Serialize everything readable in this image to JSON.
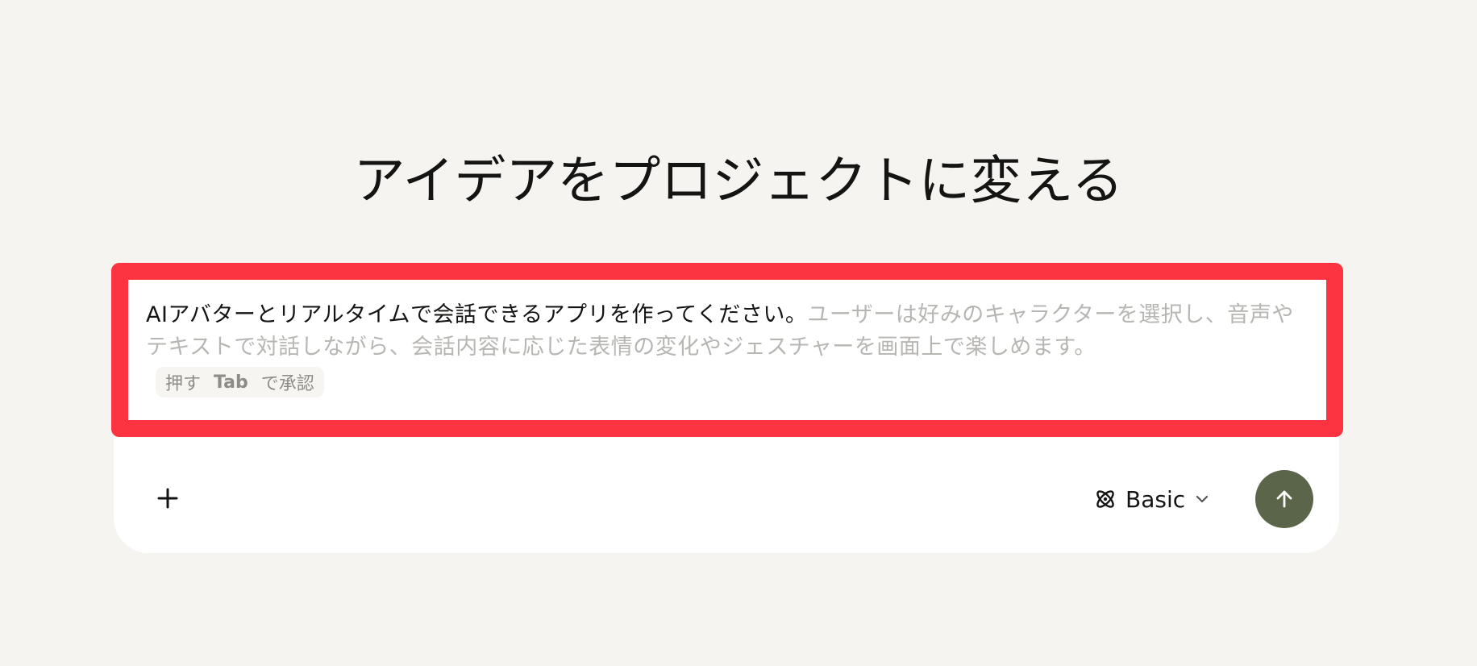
{
  "header": {
    "title": "アイデアをプロジェクトに変える"
  },
  "composer": {
    "prompt_typed": "AIアバターとリアルタイムで会話できるアプリを作ってください。",
    "prompt_suggestion": "ユーザーは好みのキャラクターを選択し、音声やテキストで対話しながら、会話内容に応じた表情の変化やジェスチャーを画面上で楽しめます。",
    "tab_hint": {
      "before": "押す",
      "key": "Tab",
      "after": "で承認"
    }
  },
  "toolbar": {
    "add_icon": "plus-icon",
    "mode_icon": "atom-icon",
    "mode_label": "Basic",
    "mode_chevron_icon": "chevron-down-icon",
    "send_icon": "arrow-up-icon"
  },
  "colors": {
    "background": "#f5f4f1",
    "highlight": "#fc3442",
    "send_button": "#5b6549",
    "suggestion_text": "#b7b6b2"
  }
}
